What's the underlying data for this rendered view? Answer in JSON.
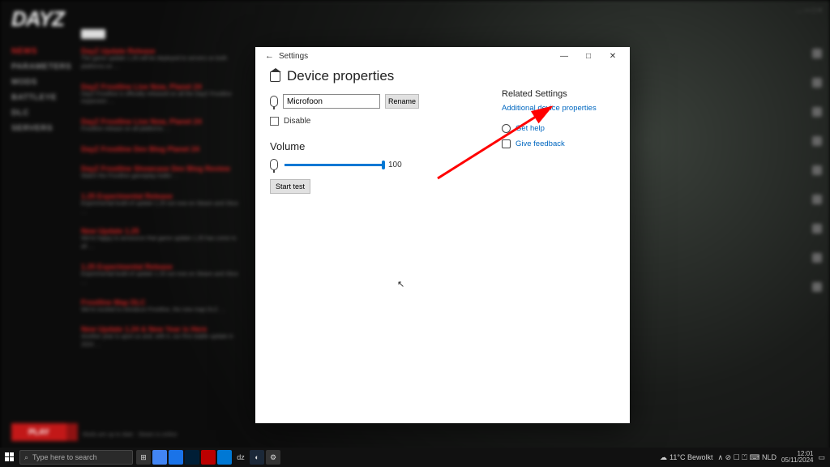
{
  "launcher": {
    "logo": "DAYZ",
    "sidebar": [
      "NEWS",
      "PARAMETERS",
      "MODS",
      "BATTLEYE",
      "DLC",
      "SERVERS"
    ],
    "play_label": "PLAY",
    "status_text": "Mods are up to date · Steam is online",
    "top_right": "…  —  □  ×",
    "news": [
      {
        "title": "DayZ Update Release",
        "body": "The game update 1.26 will be deployed to servers on both platforms on …"
      },
      {
        "title": "DayZ Frostline Live Now, Planet 24",
        "body": "DayZ Frostline is officially released on all the DayZ Frostline expansion …"
      },
      {
        "title": "DayZ Frostline Live Now, Planet 24",
        "body": "Frostline release on all platforms …"
      },
      {
        "title": "DayZ Frostline Dev Blog Planet 24",
        "body": ""
      },
      {
        "title": "DayZ Frostline Showcase Dev Blog Review",
        "body": "Watch the Frostline gameplay trailer …"
      },
      {
        "title": "1.25 Experimental Release",
        "body": "Experimental build of update 1.25 out now on Steam and Xbox …"
      },
      {
        "title": "New Update 1.25",
        "body": "We're happy to announce that game update 1.25 has come to all …"
      },
      {
        "title": "1.25 Experimental Release",
        "body": "Experimental build of update 1.25 out now on Steam and Xbox …"
      },
      {
        "title": "Frostline Map DLC",
        "body": "We're excited to introduce Frostline, the new map DLC …"
      },
      {
        "title": "New Update 1.24 & New Year is Here",
        "body": "Another year is upon us and, with it, our first stable update in 2024 …"
      }
    ]
  },
  "settings": {
    "window_title": "Settings",
    "page_title": "Device properties",
    "device_name": "Microfoon",
    "rename_label": "Rename",
    "disable_label": "Disable",
    "volume_heading": "Volume",
    "volume_value": "100",
    "start_test_label": "Start test",
    "related_heading": "Related Settings",
    "additional_link": "Additional device properties",
    "help_link": "Get help",
    "feedback_link": "Give feedback"
  },
  "taskbar": {
    "search_placeholder": "Type here to search",
    "weather_text": "11°C  Bewolkt",
    "tray_text": "∧  ⊘  ☐  ⏍  ⌨  NLD",
    "clock_time": "12:01",
    "clock_date": "05/11/2024"
  }
}
